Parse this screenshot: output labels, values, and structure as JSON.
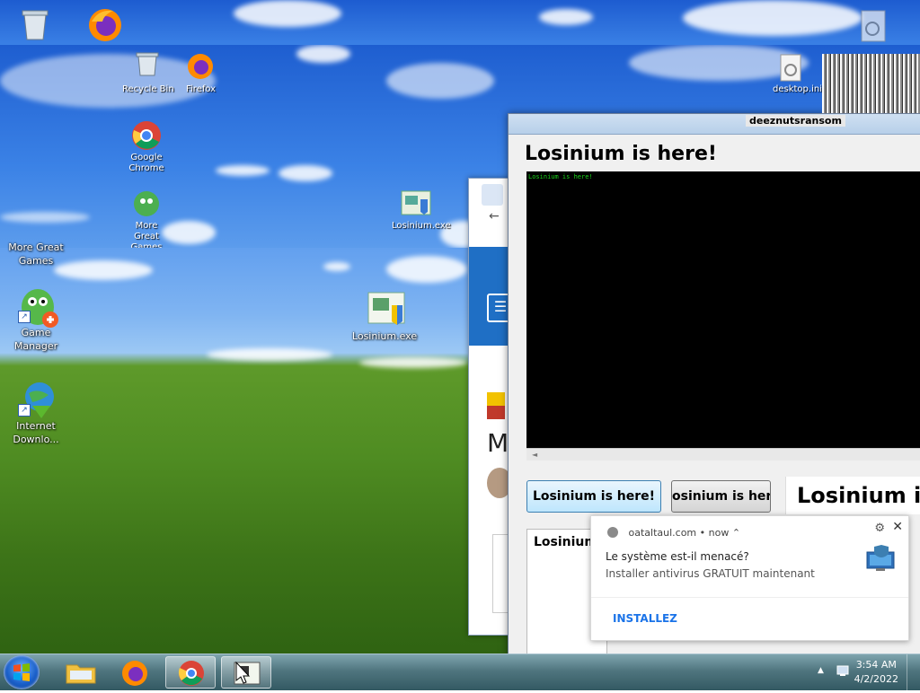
{
  "desktop": {
    "icons_lower": [
      {
        "label": "More Great Games",
        "label_lines": [
          "More Great",
          "Games"
        ]
      },
      {
        "label": "Game Manager",
        "label_lines": [
          "Game",
          "Manager"
        ]
      },
      {
        "label": "Internet Downlo...",
        "label_lines": [
          "Internet",
          "Downlo..."
        ]
      },
      {
        "label": "Losinium.exe",
        "label_lines": [
          "Losinium.exe"
        ]
      }
    ],
    "glitch_labels": {
      "recycle_bin": "Recycle Bin",
      "firefox": "Firefox",
      "chrome": "Google Chrome",
      "more_games": "More Great Games",
      "deeznuts_top": "deeznutsransom",
      "desktop_ini": "desktop.ini",
      "losinium_small": "Losinium.exe"
    }
  },
  "losinium_window": {
    "heading": "Losinium is here!",
    "console_text": "Losinium is here!",
    "scroll_arrow": "◄",
    "button1_label": "Losinium is here!",
    "button2_label": "osinium is here",
    "label_text": "Losinium is here!",
    "box_text": "Losinium"
  },
  "notification": {
    "source": "oataltaul.com",
    "time": "now",
    "title": "Le système est-il menacé?",
    "body": "Installer antivirus GRATUIT maintenant",
    "action": "INSTALLEZ",
    "close": "✕",
    "settings": "⚙"
  },
  "taskbar": {
    "clock_time": "3:54 AM",
    "clock_date": "4/2/2022",
    "tray_arrow": "▲",
    "apps": [
      "file-explorer",
      "firefox",
      "chrome",
      "losinium"
    ]
  },
  "colors": {
    "console_bg": "#000000",
    "console_text": "#19d419",
    "notif_action": "#1a73e8"
  }
}
